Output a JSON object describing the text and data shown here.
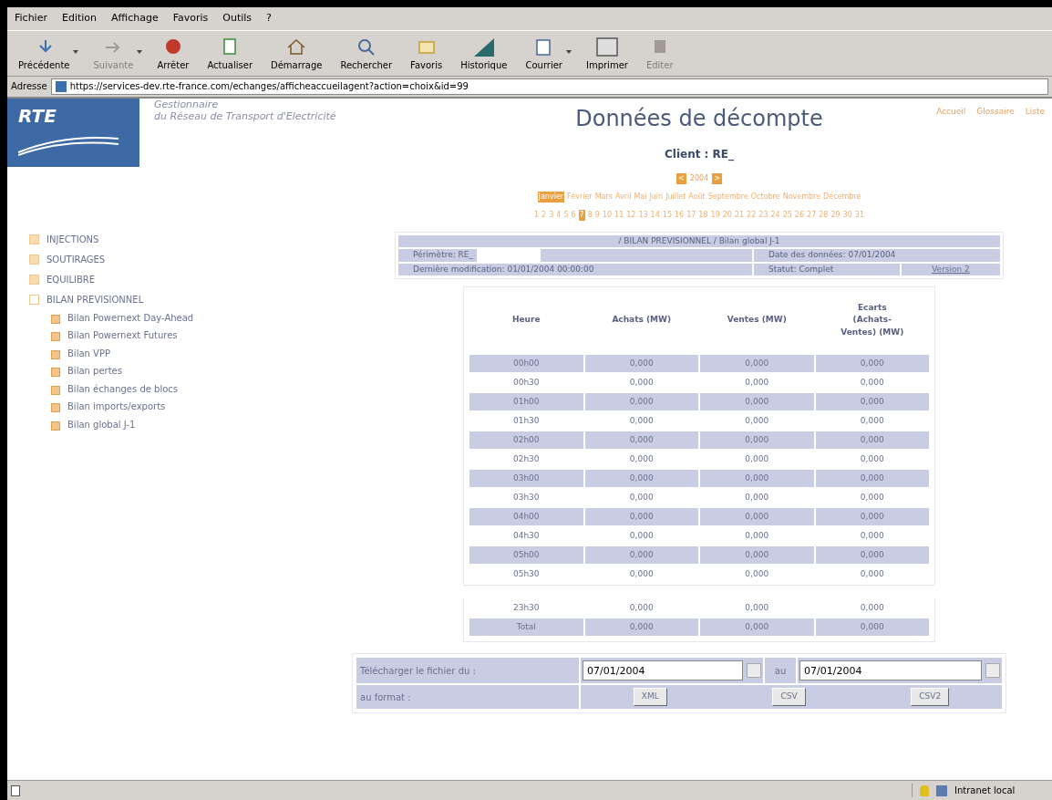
{
  "menu": [
    "Fichier",
    "Edition",
    "Affichage",
    "Favoris",
    "Outils",
    "?"
  ],
  "toolbar": [
    {
      "label": "Précédente",
      "kind": "back",
      "disabled": false,
      "dropdown": true
    },
    {
      "label": "Suivante",
      "kind": "forward",
      "disabled": true,
      "dropdown": true
    },
    {
      "label": "Arrêter",
      "kind": "stop",
      "disabled": false,
      "dropdown": false
    },
    {
      "label": "Actualiser",
      "kind": "refresh",
      "disabled": false,
      "dropdown": false
    },
    {
      "label": "Démarrage",
      "kind": "home",
      "disabled": false,
      "dropdown": false
    },
    {
      "label": "Rechercher",
      "kind": "search",
      "disabled": false,
      "dropdown": false
    },
    {
      "label": "Favoris",
      "kind": "favorites",
      "disabled": false,
      "dropdown": false
    },
    {
      "label": "Historique",
      "kind": "history",
      "disabled": false,
      "dropdown": false
    },
    {
      "label": "Courrier",
      "kind": "mail",
      "disabled": false,
      "dropdown": true
    },
    {
      "label": "Imprimer",
      "kind": "print",
      "disabled": false,
      "dropdown": false
    },
    {
      "label": "Editer",
      "kind": "edit",
      "disabled": true,
      "dropdown": false
    }
  ],
  "address": {
    "label": "Adresse",
    "value": "https://services-dev.rte-france.com/echanges/afficheaccueilagent?action=choix&id=99"
  },
  "logo": {
    "text": "RTE",
    "tagline_1": "Gestionnaire",
    "tagline_2": "du Réseau de Transport d'Electricité"
  },
  "page_title": "Données de décompte",
  "top_links": [
    "Accueil",
    "Glossaire",
    "Liste"
  ],
  "client": "Client : RE_",
  "year": {
    "prev": "<",
    "value": "2004",
    "next": ">"
  },
  "months": [
    {
      "label": "Janvier",
      "selected": true
    },
    {
      "label": "Février",
      "selected": false
    },
    {
      "label": "Mars",
      "selected": false
    },
    {
      "label": "Avril",
      "selected": false
    },
    {
      "label": "Mai",
      "selected": false
    },
    {
      "label": "Juin",
      "selected": false
    },
    {
      "label": "Juillet",
      "selected": false
    },
    {
      "label": "Août",
      "selected": false
    },
    {
      "label": "Septembre",
      "selected": false
    },
    {
      "label": "Octobre",
      "selected": false
    },
    {
      "label": "Novembre",
      "selected": false
    },
    {
      "label": "Décembre",
      "selected": false
    }
  ],
  "days": [
    {
      "label": "1",
      "selected": false
    },
    {
      "label": "2",
      "selected": false
    },
    {
      "label": "3",
      "selected": false
    },
    {
      "label": "4",
      "selected": false
    },
    {
      "label": "5",
      "selected": false
    },
    {
      "label": "6",
      "selected": false
    },
    {
      "label": "7",
      "selected": true
    },
    {
      "label": "8",
      "selected": false
    },
    {
      "label": "9",
      "selected": false
    },
    {
      "label": "10",
      "selected": false
    },
    {
      "label": "11",
      "selected": false
    },
    {
      "label": "12",
      "selected": false
    },
    {
      "label": "13",
      "selected": false
    },
    {
      "label": "14",
      "selected": false
    },
    {
      "label": "15",
      "selected": false
    },
    {
      "label": "16",
      "selected": false
    },
    {
      "label": "17",
      "selected": false
    },
    {
      "label": "18",
      "selected": false
    },
    {
      "label": "19",
      "selected": false
    },
    {
      "label": "20",
      "selected": false
    },
    {
      "label": "21",
      "selected": false
    },
    {
      "label": "22",
      "selected": false
    },
    {
      "label": "23",
      "selected": false
    },
    {
      "label": "24",
      "selected": false
    },
    {
      "label": "25",
      "selected": false
    },
    {
      "label": "26",
      "selected": false
    },
    {
      "label": "27",
      "selected": false
    },
    {
      "label": "28",
      "selected": false
    },
    {
      "label": "29",
      "selected": false
    },
    {
      "label": "30",
      "selected": false
    },
    {
      "label": "31",
      "selected": false
    }
  ],
  "sidebar": [
    {
      "label": "INJECTIONS",
      "expanded": false
    },
    {
      "label": "SOUTIRAGES",
      "expanded": false
    },
    {
      "label": "EQUILIBRE",
      "expanded": false
    },
    {
      "label": "BILAN PREVISIONNEL",
      "expanded": true,
      "children": [
        "Bilan Powernext Day-Ahead",
        "Bilan Powernext Futures",
        "Bilan VPP",
        "Bilan pertes",
        "Bilan échanges de blocs",
        "Bilan imports/exports",
        "Bilan global J-1"
      ]
    }
  ],
  "info": {
    "path": "/ BILAN PREVISIONNEL / Bilan global J-1",
    "perimetre": "Périmètre: RE_",
    "date": "Date des données: 07/01/2004",
    "modification": "Dernière modification: 01/01/2004 00:00:00",
    "statut": "Statut: Complet",
    "version_button": "Version 2"
  },
  "table": {
    "columns": [
      "Heure",
      "Achats (MW)",
      "Ventes (MW)",
      "Ecarts (Achats-Ventes) (MW)"
    ],
    "rows": [
      [
        "00h00",
        "0,000",
        "0,000",
        "0,000"
      ],
      [
        "00h30",
        "0,000",
        "0,000",
        "0,000"
      ],
      [
        "01h00",
        "0,000",
        "0,000",
        "0,000"
      ],
      [
        "01h30",
        "0,000",
        "0,000",
        "0,000"
      ],
      [
        "02h00",
        "0,000",
        "0,000",
        "0,000"
      ],
      [
        "02h30",
        "0,000",
        "0,000",
        "0,000"
      ],
      [
        "03h00",
        "0,000",
        "0,000",
        "0,000"
      ],
      [
        "03h30",
        "0,000",
        "0,000",
        "0,000"
      ],
      [
        "04h00",
        "0,000",
        "0,000",
        "0,000"
      ],
      [
        "04h30",
        "0,000",
        "0,000",
        "0,000"
      ],
      [
        "05h00",
        "0,000",
        "0,000",
        "0,000"
      ],
      [
        "05h30",
        "0,000",
        "0,000",
        "0,000"
      ]
    ],
    "tail_rows": [
      [
        "23h30",
        "0,000",
        "0,000",
        "0,000"
      ],
      [
        "Total",
        "0,000",
        "0,000",
        "0,000"
      ]
    ]
  },
  "download": {
    "label": "Télécharger le fichier du :",
    "from": "07/01/2004",
    "to_label": "au",
    "to": "07/01/2004",
    "format_label": "au format :",
    "formats": [
      "XML",
      "CSV",
      "CSV2"
    ]
  },
  "status_bar": {
    "zone": "Intranet local"
  }
}
